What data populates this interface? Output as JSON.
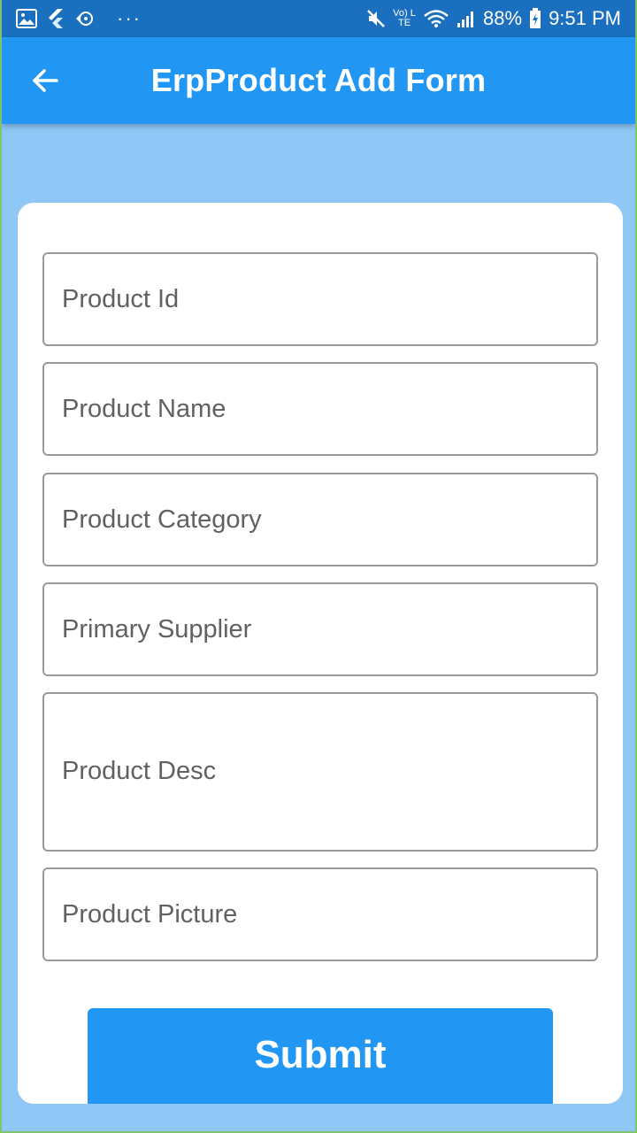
{
  "status_bar": {
    "icons_left": [
      "image-icon",
      "flutter-icon",
      "sync-icon",
      "more-dots-icon"
    ],
    "more_dots": "···",
    "mute_icon": "mute-icon",
    "volte_label": "Vo) LTE",
    "wifi_icon": "wifi-icon",
    "signal_icon": "signal-icon",
    "battery_percent": "88%",
    "battery_icon": "battery-charging-icon",
    "time": "9:51 PM"
  },
  "app_bar": {
    "back_icon": "arrow-left-icon",
    "title": "ErpProduct Add Form",
    "background_color": "#2196f3"
  },
  "form": {
    "fields": [
      {
        "name": "product-id-field",
        "placeholder": "Product Id",
        "value": ""
      },
      {
        "name": "product-name-field",
        "placeholder": "Product Name",
        "value": ""
      },
      {
        "name": "product-category-field",
        "placeholder": "Product Category",
        "value": ""
      },
      {
        "name": "primary-supplier-field",
        "placeholder": "Primary Supplier",
        "value": ""
      },
      {
        "name": "product-desc-field",
        "placeholder": "Product Desc",
        "value": ""
      },
      {
        "name": "product-picture-field",
        "placeholder": "Product Picture",
        "value": ""
      }
    ],
    "submit_label": "Submit"
  },
  "colors": {
    "accent": "#2196f3",
    "page_background": "#8fc8f7",
    "card_background": "#ffffff",
    "field_border": "#9a9a9a",
    "placeholder_text": "#616161"
  }
}
